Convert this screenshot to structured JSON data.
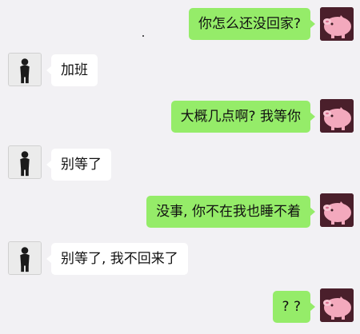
{
  "chat": {
    "messages": [
      {
        "sender": "me",
        "text": "你怎么还没回家?",
        "avatar": "pig-avatar"
      },
      {
        "sender": "contact",
        "text": "加班",
        "avatar": "person-avatar"
      },
      {
        "sender": "me",
        "text": "大概几点啊? 我等你",
        "avatar": "pig-avatar"
      },
      {
        "sender": "contact",
        "text": "别等了",
        "avatar": "person-avatar"
      },
      {
        "sender": "me",
        "text": "没事, 你不在我也睡不着",
        "avatar": "pig-avatar"
      },
      {
        "sender": "contact",
        "text": "别等了, 我不回来了",
        "avatar": "person-avatar"
      },
      {
        "sender": "me",
        "text": "? ?",
        "avatar": "pig-avatar"
      }
    ]
  },
  "colors": {
    "background": "#f2f1f4",
    "outgoing_bubble": "#95ec69",
    "incoming_bubble": "#ffffff",
    "pig_avatar_bg": "#4a1f2b",
    "pig_color": "#f3a9bd"
  }
}
